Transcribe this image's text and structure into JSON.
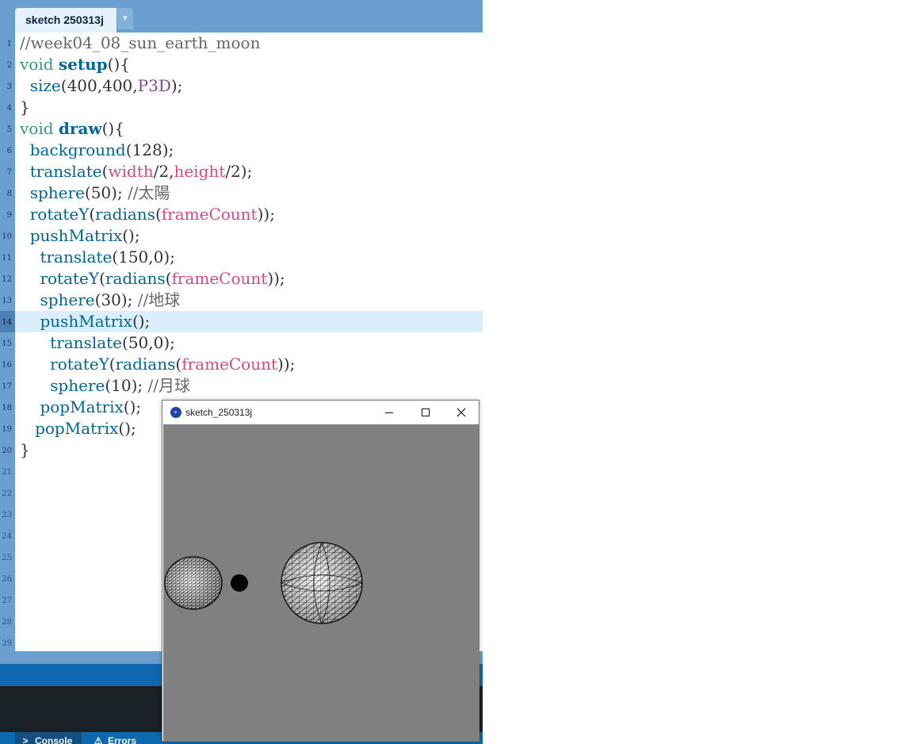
{
  "editor": {
    "tab_label": "sketch 250313j",
    "tab_menu_icon": "▼",
    "current_line": 14,
    "line_numbers": [
      "1",
      "2",
      "3",
      "4",
      "5",
      "6",
      "7",
      "8",
      "9",
      "10",
      "11",
      "12",
      "13",
      "14",
      "15",
      "16",
      "17",
      "18",
      "19",
      "20",
      "21",
      "22",
      "23",
      "24",
      "25",
      "26",
      "27",
      "28",
      "29"
    ],
    "code_lines": [
      "//week04_08_sun_earth_moon",
      "void setup(){",
      "  size(400,400,P3D);",
      "}",
      "void draw(){",
      "  background(128);",
      "  translate(width/2,height/2);",
      "  sphere(50); //太陽",
      "  rotateY(radians(frameCount));",
      "  pushMatrix();",
      "    translate(150,0);",
      "    rotateY(radians(frameCount));",
      "    sphere(30); //地球",
      "    pushMatrix();",
      "      translate(50,0);",
      "      rotateY(radians(frameCount));",
      "      sphere(10); //月球",
      "    popMatrix();",
      "   popMatrix();",
      "}"
    ]
  },
  "console": {
    "tabs": [
      {
        "label": "Console",
        "icon": "terminal-icon"
      },
      {
        "label": "Errors",
        "icon": "warning-icon"
      }
    ]
  },
  "sketch_window": {
    "title": "sketch_250313j",
    "background_color": "#808080",
    "buttons": [
      "minimize",
      "maximize",
      "close"
    ]
  },
  "colors": {
    "ide_blue": "#6a9fcf",
    "ide_dark_blue": "#0e68ad",
    "current_line_highlight": "#dbeefc",
    "keyword": "#33997e",
    "function": "#006699",
    "variable": "#d94a7a",
    "constant": "#7d4793",
    "comment": "#666666"
  }
}
